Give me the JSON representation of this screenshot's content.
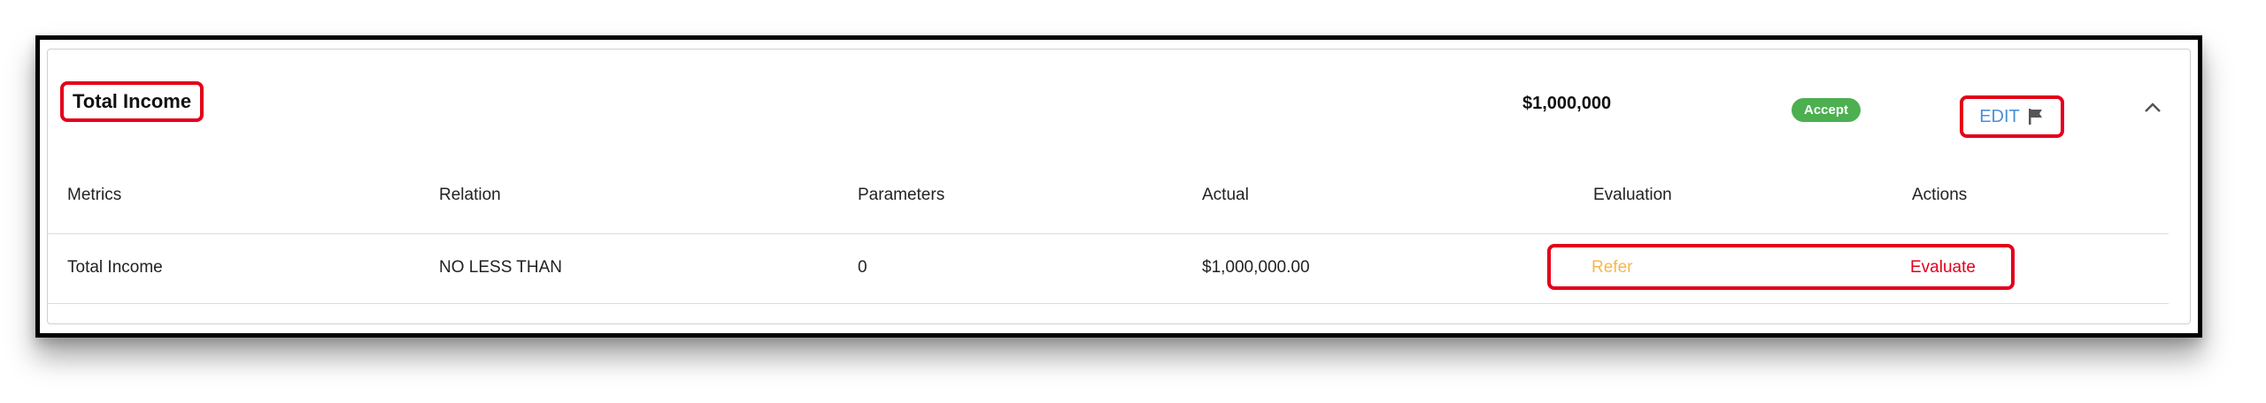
{
  "section": {
    "title": "Total Income",
    "amount": "$1,000,000",
    "status_badge": "Accept",
    "edit_label": "EDIT"
  },
  "table": {
    "headers": [
      "Metrics",
      "Relation",
      "Parameters",
      "Actual",
      "Evaluation",
      "Actions"
    ],
    "rows": [
      {
        "metric": "Total Income",
        "relation": "NO LESS THAN",
        "parameter": "0",
        "actual": "$1,000,000.00",
        "evaluation": "Refer",
        "action": "Evaluate"
      }
    ]
  },
  "colors": {
    "accept": "#4caf50",
    "edit": "#4a90d9",
    "refer": "#f5b84c",
    "evaluate": "#e3001b",
    "highlight": "#e3001b"
  },
  "icons": {
    "edit": "flag-icon",
    "collapse": "chevron-up-icon"
  }
}
